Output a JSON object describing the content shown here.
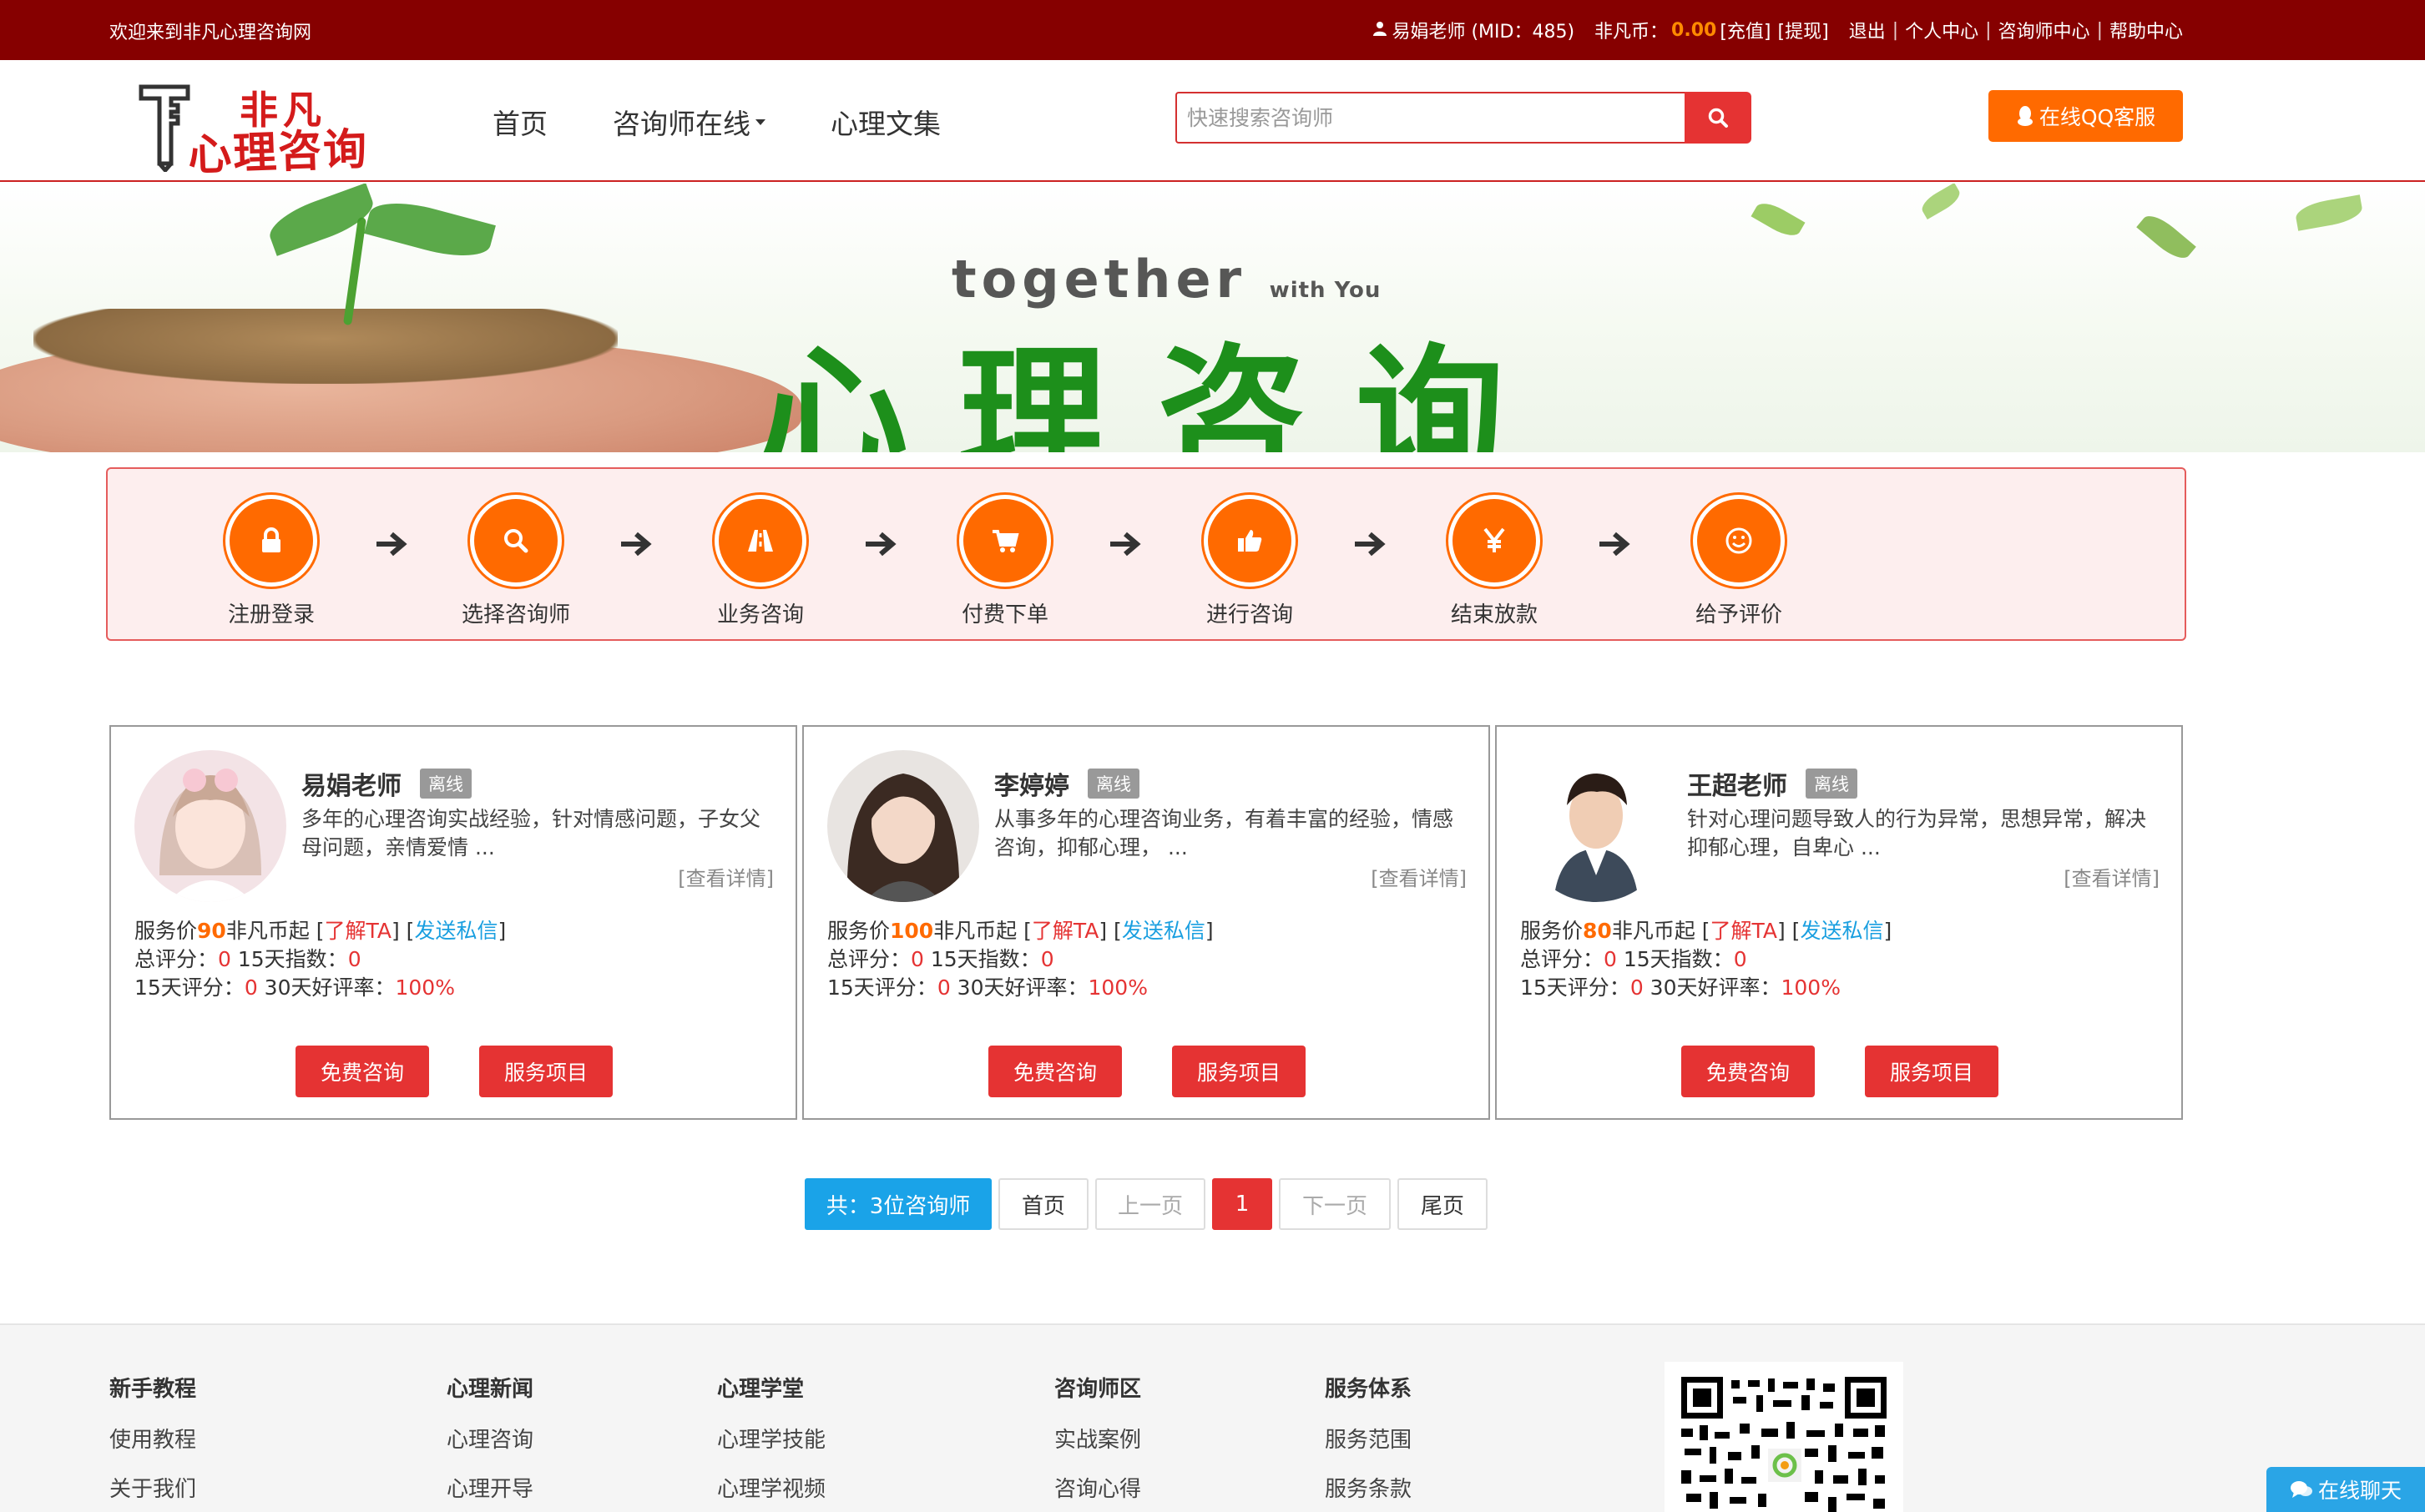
{
  "topbar": {
    "welcome": "欢迎来到非凡心理咨询网",
    "user": "易娟老师 (MID：485)",
    "coins_label": "非凡币：",
    "coins_value": "0.00",
    "recharge": "[充值]",
    "withdraw": "[提现]",
    "logout": "退出",
    "personal_center": "个人中心",
    "counselor_center": "咨询师中心",
    "help_center": "帮助中心"
  },
  "header": {
    "logo_line1": "非凡",
    "logo_line2": "心理咨询",
    "nav": [
      "首页",
      "咨询师在线",
      "心理文集"
    ],
    "search_placeholder": "快速搜索咨询师",
    "qq_service": "在线QQ客服"
  },
  "banner": {
    "together": "together",
    "with_you": "with You",
    "big_title": "心理咨询"
  },
  "process": {
    "steps": [
      {
        "label": "注册登录",
        "icon": "lock-icon"
      },
      {
        "label": "选择咨询师",
        "icon": "search-icon"
      },
      {
        "label": "业务咨询",
        "icon": "road-icon"
      },
      {
        "label": "付费下单",
        "icon": "cart-icon"
      },
      {
        "label": "进行咨询",
        "icon": "thumbs-up-icon"
      },
      {
        "label": "结束放款",
        "icon": "yen-icon"
      },
      {
        "label": "给予评价",
        "icon": "smile-icon"
      }
    ]
  },
  "counselors": [
    {
      "name": "易娟老师",
      "status": "离线",
      "desc": "多年的心理咨询实战经验，针对情感问题，子女父母问题，亲情爱情 ...",
      "more": "查看详情",
      "price_prefix": "服务价",
      "price": "90",
      "price_suffix": "非凡币起",
      "about": "了解TA",
      "message": "发送私信",
      "total_score_label": "总评分：",
      "total_score": "0",
      "index15_label": "15天指数：",
      "index15": "0",
      "score15_label": "15天评分：",
      "score15": "0",
      "rate30_label": "30天好评率：",
      "rate30": "100%",
      "btn_free": "免费咨询",
      "btn_service": "服务项目"
    },
    {
      "name": "李婷婷",
      "status": "离线",
      "desc": "从事多年的心理咨询业务，有着丰富的经验，情感咨询，抑郁心理， ...",
      "more": "查看详情",
      "price_prefix": "服务价",
      "price": "100",
      "price_suffix": "非凡币起",
      "about": "了解TA",
      "message": "发送私信",
      "total_score_label": "总评分：",
      "total_score": "0",
      "index15_label": "15天指数：",
      "index15": "0",
      "score15_label": "15天评分：",
      "score15": "0",
      "rate30_label": "30天好评率：",
      "rate30": "100%",
      "btn_free": "免费咨询",
      "btn_service": "服务项目"
    },
    {
      "name": "王超老师",
      "status": "离线",
      "desc": "针对心理问题导致人的行为异常，思想异常，解决抑郁心理，自卑心 ...",
      "more": "查看详情",
      "price_prefix": "服务价",
      "price": "80",
      "price_suffix": "非凡币起",
      "about": "了解TA",
      "message": "发送私信",
      "total_score_label": "总评分：",
      "total_score": "0",
      "index15_label": "15天指数：",
      "index15": "0",
      "score15_label": "15天评分：",
      "score15": "0",
      "rate30_label": "30天好评率：",
      "rate30": "100%",
      "btn_free": "免费咨询",
      "btn_service": "服务项目"
    }
  ],
  "pagination": {
    "total": "共：3位咨询师",
    "first": "首页",
    "prev": "上一页",
    "current": "1",
    "next": "下一页",
    "last": "尾页"
  },
  "footer": {
    "columns": [
      {
        "title": "新手教程",
        "links": [
          "使用教程",
          "关于我们"
        ]
      },
      {
        "title": "心理新闻",
        "links": [
          "心理咨询",
          "心理开导"
        ]
      },
      {
        "title": "心理学堂",
        "links": [
          "心理学技能",
          "心理学视频"
        ]
      },
      {
        "title": "咨询师区",
        "links": [
          "实战案例",
          "咨询心得"
        ]
      },
      {
        "title": "服务体系",
        "links": [
          "服务范围",
          "服务条款"
        ]
      }
    ],
    "chat": "在线聊天"
  },
  "colors": {
    "topbar_bg": "#860000",
    "accent_red": "#e53333",
    "accent_orange": "#ff6a00",
    "link_blue": "#1a9fe0"
  }
}
